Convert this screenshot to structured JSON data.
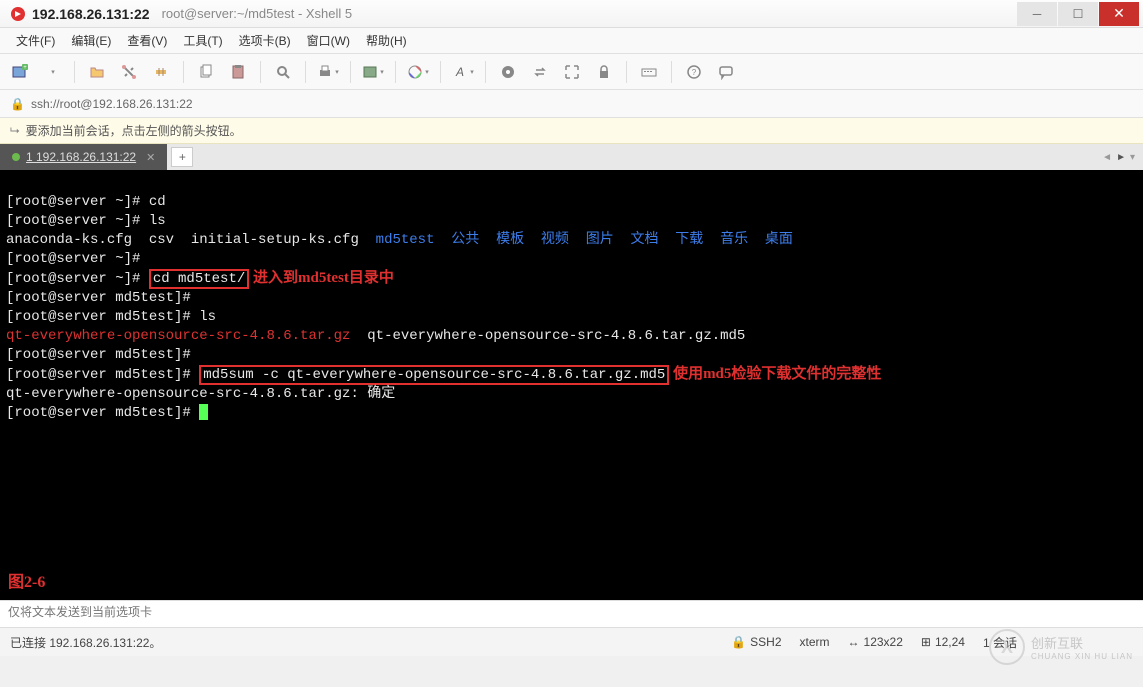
{
  "window": {
    "title_main": "192.168.26.131:22",
    "title_sub": "root@server:~/md5test - Xshell 5"
  },
  "menu": [
    "文件(F)",
    "编辑(E)",
    "查看(V)",
    "工具(T)",
    "选项卡(B)",
    "窗口(W)",
    "帮助(H)"
  ],
  "address": "ssh://root@192.168.26.131:22",
  "info_text": "要添加当前会话，点击左侧的箭头按钮。",
  "tab": {
    "label": "1 192.168.26.131:22"
  },
  "terminal": {
    "l1_prompt": "[root@server ~]# ",
    "l1_cmd": "cd",
    "l2_prompt": "[root@server ~]# ",
    "l2_cmd": "ls",
    "l3_files": "anaconda-ks.cfg  csv  initial-setup-ks.cfg  ",
    "l3_dir": "md5test",
    "l3_dirs_cn": "  公共  模板  视频  图片  文档  下载  音乐  桌面",
    "l4_prompt": "[root@server ~]#",
    "l5_prompt": "[root@server ~]# ",
    "l5_cmd": "cd md5test/",
    "l5_anno": " 进入到md5test目录中",
    "l6_prompt": "[root@server md5test]#",
    "l7_prompt": "[root@server md5test]# ",
    "l7_cmd": "ls",
    "l8_file_red": "qt-everywhere-opensource-src-4.8.6.tar.gz",
    "l8_file_white": "  qt-everywhere-opensource-src-4.8.6.tar.gz.md5",
    "l9_prompt": "[root@server md5test]#",
    "l10_prompt": "[root@server md5test]# ",
    "l10_cmd": "md5sum -c qt-everywhere-opensource-src-4.8.6.tar.gz.md5",
    "l10_anno": " 使用md5检验下载文件的完整性",
    "l11_result": "qt-everywhere-opensource-src-4.8.6.tar.gz: 确定",
    "l12_prompt": "[root@server md5test]# ",
    "fig_label": "图2-6"
  },
  "input_placeholder": "仅将文本发送到当前选项卡",
  "status": {
    "left": "已连接 192.168.26.131:22。",
    "ssh": "SSH2",
    "term": "xterm",
    "size": "123x22",
    "pos": "12,24",
    "sessions": "1 会话"
  },
  "watermark": {
    "main": "创新互联",
    "sub": "CHUANG XIN HU LIAN"
  }
}
